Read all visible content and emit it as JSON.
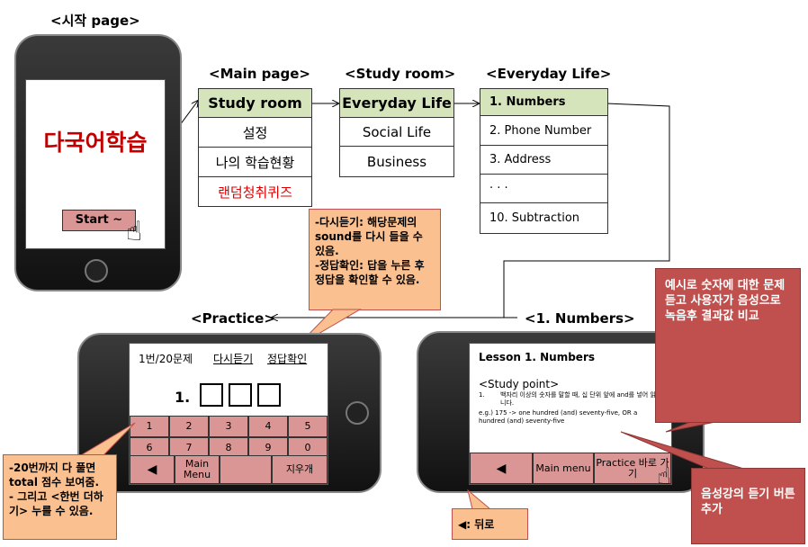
{
  "start_page": {
    "title": "<시작 page>",
    "app_title": "다국어학습",
    "start_button": "Start ~"
  },
  "main_page": {
    "title": "<Main page>",
    "items": [
      "Study room",
      "설정",
      "나의 학습현황",
      "랜덤청취퀴즈"
    ]
  },
  "study_room": {
    "title": "<Study room>",
    "items": [
      "Everyday Life",
      "Social Life",
      "Business"
    ]
  },
  "everyday_life": {
    "title": "<Everyday Life>",
    "items": [
      "1. Numbers",
      "2. Phone Number",
      "3. Address",
      "· · ·",
      "10. Subtraction"
    ]
  },
  "practice": {
    "title": "<Practice>",
    "progress": "1번/20문제",
    "replay": "다시듣기",
    "check_answer": "정답확인",
    "question_number": "1.",
    "keys": [
      "1",
      "2",
      "3",
      "4",
      "5",
      "6",
      "7",
      "8",
      "9",
      "0"
    ],
    "back": "◀",
    "main_menu": "Main Menu",
    "erase": "지우개"
  },
  "numbers": {
    "title": "<1. Numbers>",
    "lesson": "Lesson  1. Numbers",
    "study_point": "<Study point>",
    "point_num": "1.",
    "point_text": "백자리 이상의 숫자를 말할 때, 십 단위 앞에 and를 넣어 읽습니다.",
    "example": "e.g.) 175 -> one hundred (and) seventy-five, OR a hundred (and) seventy-five",
    "back": "◀",
    "main_menu": "Main menu",
    "practice_button": "Practice 바로 가기"
  },
  "callouts": {
    "practice_note": "-다시듣기: 해당문제의 sound를 다시 들을 수 있음.\n-정답확인: 답을 누른 후 정답을 확인할 수 있음.",
    "score_note": "-20번까지 다 풀면 total 점수 보여줌.\n- 그리고 <한번 더하기> 누를 수 있음.",
    "back_note": "◀: 뒤로",
    "voice_note": "예시로 숫자에 대한 문제 듣고 사용자가 음성으로 녹음후 결과값 비교",
    "listen_note": "음성강의 듣기 버튼 추가"
  },
  "colors": {
    "selected_row": "#d6e4bc",
    "key_pink": "#d99694",
    "orange_callout": "#fac090",
    "red_callout": "#c0504d",
    "app_title": "#c00000"
  }
}
